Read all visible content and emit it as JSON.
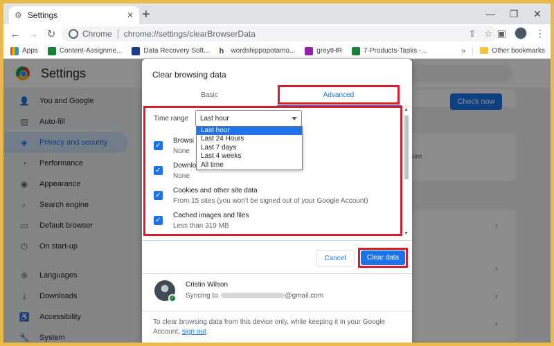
{
  "browser": {
    "tab_title": "Settings",
    "tab_close": "✕",
    "new_tab": "+",
    "omnibox_chip": "Chrome",
    "url": "chrome://settings/clearBrowserData",
    "win_min": "—",
    "win_max": "❐",
    "win_close": "✕"
  },
  "bookmarks": {
    "items": [
      {
        "label": "Apps",
        "color": "#5f6368"
      },
      {
        "label": "Content-Assignme...",
        "color": "#188038"
      },
      {
        "label": "Data Recovery Soft...",
        "color": "#1a3c8a"
      },
      {
        "label": "wordshippopotamo...",
        "color": "#5f3a1c"
      },
      {
        "label": "greytHR",
        "color": "#8e24aa"
      },
      {
        "label": "7-Products-Tasks -...",
        "color": "#188038"
      }
    ],
    "overflow": "»",
    "other": "Other bookmarks"
  },
  "settings": {
    "title": "Settings",
    "sidebar": [
      {
        "label": "You and Google",
        "icon": "person-icon",
        "glyph": "👤"
      },
      {
        "label": "Auto-fill",
        "icon": "clipboard-icon",
        "glyph": "▤"
      },
      {
        "label": "Privacy and security",
        "icon": "shield-icon",
        "glyph": "◈",
        "active": true
      },
      {
        "label": "Performance",
        "icon": "gauge-icon",
        "glyph": "◔"
      },
      {
        "label": "Appearance",
        "icon": "palette-icon",
        "glyph": "◉"
      },
      {
        "label": "Search engine",
        "icon": "search-icon",
        "glyph": "⌕"
      },
      {
        "label": "Default browser",
        "icon": "browser-icon",
        "glyph": "▭"
      },
      {
        "label": "On start-up",
        "icon": "power-icon",
        "glyph": "⏻"
      },
      {
        "label": "Languages",
        "icon": "globe-icon",
        "glyph": "⊕"
      },
      {
        "label": "Downloads",
        "icon": "download-icon",
        "glyph": "⤓"
      },
      {
        "label": "Accessibility",
        "icon": "accessibility-icon",
        "glyph": "♿"
      },
      {
        "label": "System",
        "icon": "wrench-icon",
        "glyph": "🔧"
      }
    ],
    "check_now": "Check now",
    "now_fragment": "ore"
  },
  "dialog": {
    "title": "Clear browsing data",
    "tab_basic": "Basic",
    "tab_advanced": "Advanced",
    "time_range_label": "Time range",
    "time_range_value": "Last hour",
    "time_range_options": [
      "Last hour",
      "Last 24 Hours",
      "Last 7 days",
      "Last 4 weeks",
      "All time"
    ],
    "items": [
      {
        "label": "Browsi",
        "sub": "None",
        "checked": true
      },
      {
        "label": "Downlo",
        "sub": "None",
        "checked": true
      },
      {
        "label": "Cookies and other site data",
        "sub": "From 15 sites (you won't be signed out of your Google Account)",
        "checked": true
      },
      {
        "label": "Cached images and files",
        "sub": "Less than 319 MB",
        "checked": true
      }
    ],
    "cancel": "Cancel",
    "clear": "Clear data",
    "profile_name": "Cristin Wilson",
    "syncing_prefix": "Syncing to",
    "syncing_suffix": "@gmail.com",
    "note_text": "To clear browsing data from this device only, while keeping it in your Google Account,",
    "sign_out": "sign out",
    "note_end": "."
  },
  "colors": {
    "accent": "#1a73e8",
    "highlight_red": "#d81e2c",
    "outer_border": "#e9b949"
  }
}
